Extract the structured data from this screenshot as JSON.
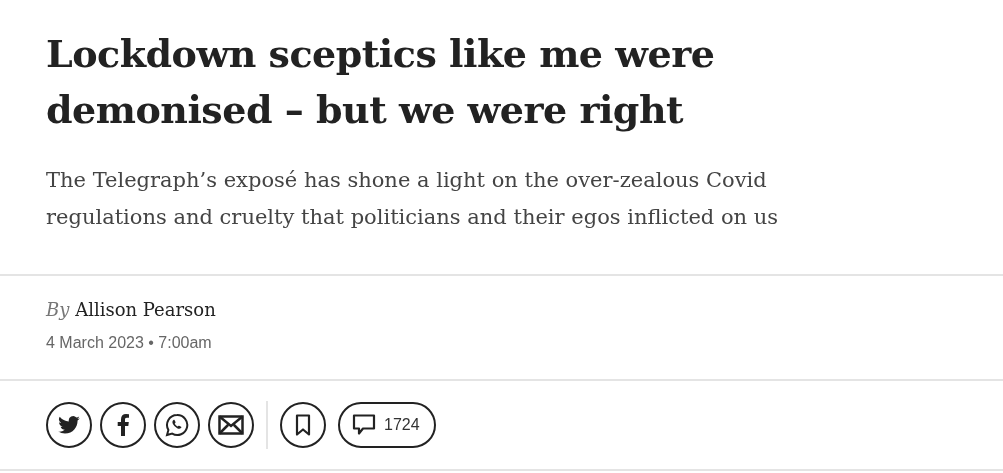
{
  "headline": "Lockdown sceptics like me were demonised – but we were right",
  "standfirst": "The Telegraph’s exposé has shone a light on the over-zealous Covid regulations and cruelty that politicians and their egos inflicted on us",
  "byline": {
    "prefix": "By",
    "author": "Allison Pearson"
  },
  "date": "4 March 2023 • 7:00am",
  "comments": {
    "count": "1724"
  }
}
